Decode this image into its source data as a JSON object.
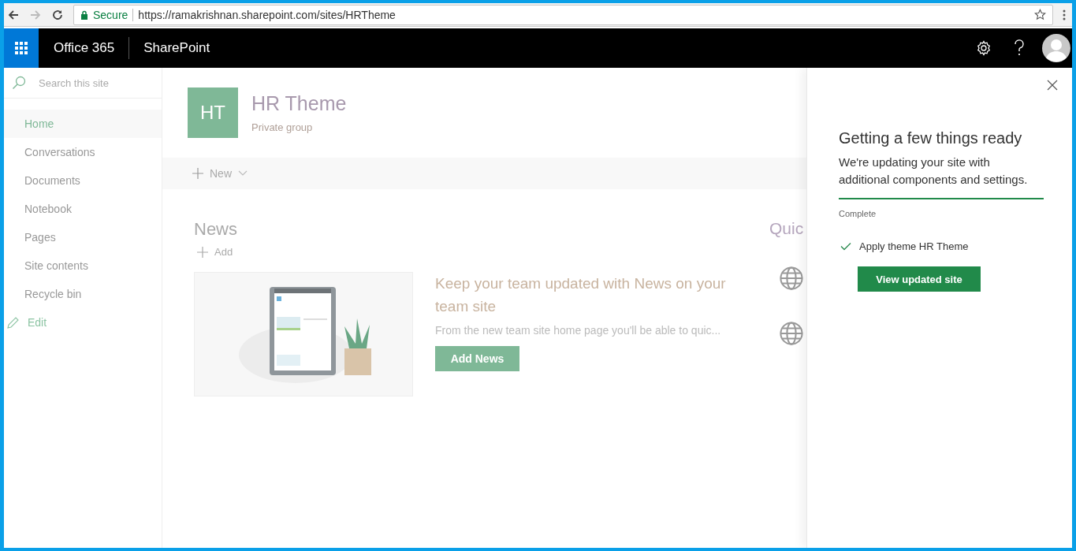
{
  "browser": {
    "security": "Secure",
    "url": "https://ramakrishnan.sharepoint.com/sites/HRTheme"
  },
  "suite_bar": {
    "brand": "Office 365",
    "app": "SharePoint"
  },
  "sidebar": {
    "search_placeholder": "Search this site",
    "items": [
      {
        "label": "Home",
        "selected": true
      },
      {
        "label": "Conversations",
        "selected": false
      },
      {
        "label": "Documents",
        "selected": false
      },
      {
        "label": "Notebook",
        "selected": false
      },
      {
        "label": "Pages",
        "selected": false
      },
      {
        "label": "Site contents",
        "selected": false
      },
      {
        "label": "Recycle bin",
        "selected": false
      }
    ],
    "edit": "Edit"
  },
  "site_header": {
    "initials": "HT",
    "title": "HR Theme",
    "subtitle": "Private group"
  },
  "command_bar": {
    "new": "New"
  },
  "news": {
    "heading": "News",
    "add": "Add",
    "card": {
      "kind": "picture",
      "title": "Keep your team updated with News on your team site",
      "description": "From the new team site home page you'll be able to quic...",
      "button": "Add News"
    }
  },
  "quick_links": {
    "heading": "Quic",
    "links": [
      {
        "kind": "globe"
      },
      {
        "kind": "globe"
      }
    ]
  },
  "panel": {
    "title": "Getting a few things ready",
    "message": "We're updating your site with additional components and settings.",
    "progress": {
      "level": 1.0,
      "status": "Complete"
    },
    "tasks": [
      {
        "label": "Apply theme HR Theme",
        "done": true
      }
    ],
    "button": "View updated site"
  }
}
